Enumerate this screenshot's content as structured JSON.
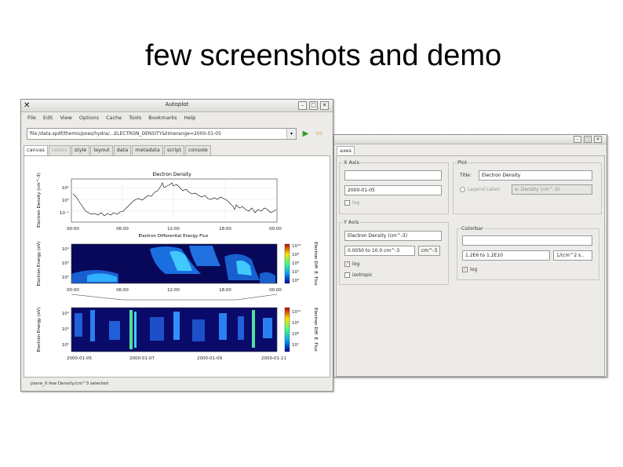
{
  "slide": {
    "title": "few screenshots and demo"
  },
  "main_window": {
    "title": "Autoplot",
    "menu": [
      "File",
      "Edit",
      "View",
      "Options",
      "Cache",
      "Tools",
      "Bookmarks",
      "Help"
    ],
    "url": "file:/data.spdf/themis/poes/hydra/...ELECTRON_DENSITY&timerange=2000-01-05",
    "tabs": [
      "canvas",
      "tables",
      "style",
      "layout",
      "data",
      "metadata",
      "script",
      "console"
    ],
    "status": "plane_0 few Density/cm^3 selected",
    "plots": {
      "panel1": {
        "title": "Electron Density",
        "ylabel": "Electron Density (cm^-3)",
        "xlabel": "Electron Differential Energy Flux",
        "xticks": [
          "00:00",
          "06:00",
          "12:00",
          "18:00",
          "00:00"
        ],
        "yticks": [
          "10¹",
          "10⁰",
          "10⁻¹"
        ]
      },
      "panel2": {
        "ylabel": "Electron Energy (eV)",
        "clabel": "Electron Diff. E. Flux",
        "xticks": [
          "00:00",
          "06:00",
          "12:00",
          "18:00",
          "00:00"
        ],
        "yticks": [
          "10⁴",
          "10³",
          "10²"
        ],
        "cticks": [
          "10¹⁰",
          "10⁹",
          "10⁸",
          "10⁷",
          "10⁶"
        ]
      },
      "panel3": {
        "ylabel": "Electron Energy (eV)",
        "clabel": "Electron Diff. E. Flux",
        "xticks": [
          "2000-01-05",
          "2000-01-07",
          "2000-01-09",
          "2000-01-11"
        ],
        "yticks": [
          "10⁴",
          "10³",
          "10²"
        ],
        "cticks": [
          "10¹⁰",
          "10⁹",
          "10⁸",
          "10⁷"
        ]
      }
    }
  },
  "axes_dialog": {
    "tab": "axes",
    "xaxis": {
      "label": "X Axis",
      "title_value": "",
      "range_value": "2000-01-05",
      "log_label": "log"
    },
    "plot": {
      "label": "Plot",
      "title_label": "Title:",
      "title_value": "Electron Density",
      "legend_label": "Legend Label:",
      "legend_value": "e- Density (cm^-3)"
    },
    "yaxis": {
      "label": "Y Axis",
      "title_value": "Electron Density (cm^-3)",
      "range_value": "0.0050 to 10.0 cm^-3",
      "units_button": "cm^-3",
      "log_label": "log",
      "isotropic_label": "isotropic"
    },
    "colorbar": {
      "label": "Colorbar",
      "title_value": "",
      "range_value": "1.2E6 to 1.2E10",
      "units_value": "1/(cm^2 s..",
      "log_label": "log"
    }
  }
}
